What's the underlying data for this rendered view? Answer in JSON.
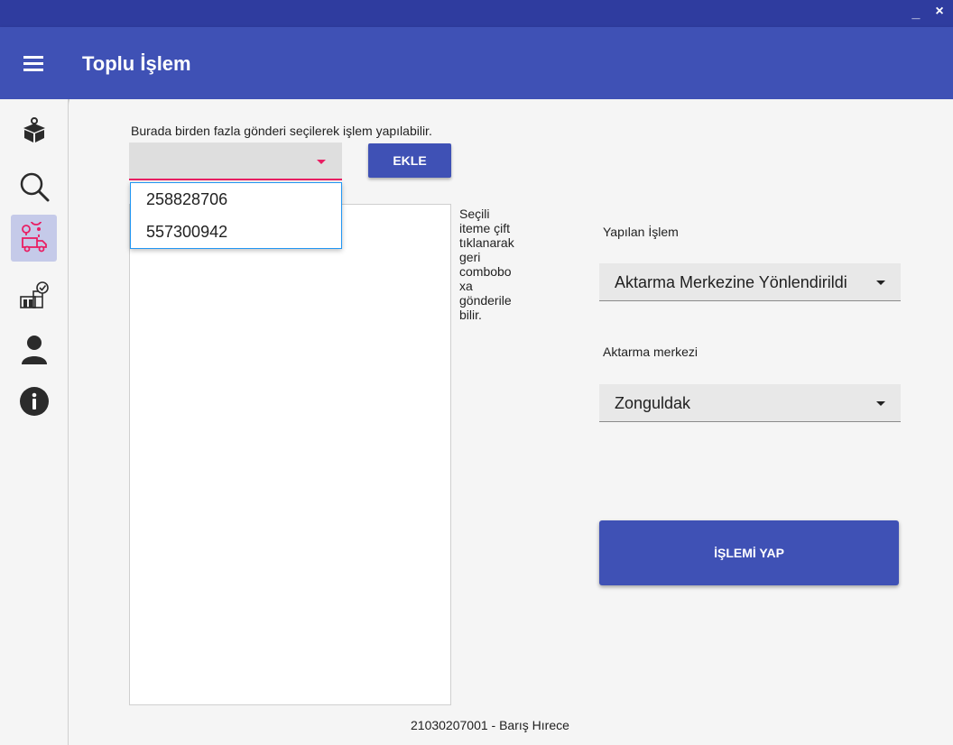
{
  "window": {
    "minimize_label": "_",
    "close_label": "×"
  },
  "appbar": {
    "title": "Toplu İşlem",
    "menu_icon": "hamburger-menu-icon",
    "color": "#3f51b5"
  },
  "sidebar": {
    "items": [
      {
        "name": "box-icon",
        "active": false
      },
      {
        "name": "search-icon",
        "active": true
      },
      {
        "name": "delivery-route-icon",
        "active": true
      },
      {
        "name": "warehouse-check-icon",
        "active": false
      },
      {
        "name": "user-icon",
        "active": false
      },
      {
        "name": "info-icon",
        "active": false
      }
    ],
    "active_color": "#c5cae9"
  },
  "main": {
    "hint": "Burada birden fazla gönderi seçilerek işlem yapılabilir.",
    "add_button": "EKLE",
    "dropdown_options": [
      "258828706",
      "557300942"
    ],
    "note": "Seçili\niteme çift\ntıklanarak\ngeri\ncombobo\nxa\ngönderile\nbilir.",
    "operation_label": "Yapılan İşlem",
    "operation_value": "Aktarma Merkezine Yönlendirildi",
    "center_label": "Aktarma merkezi",
    "center_value": "Zonguldak",
    "action_button": "İŞLEMİ YAP",
    "accent_color": "#e91e63"
  },
  "status": {
    "user": "21030207001 - Barış Hırece"
  }
}
